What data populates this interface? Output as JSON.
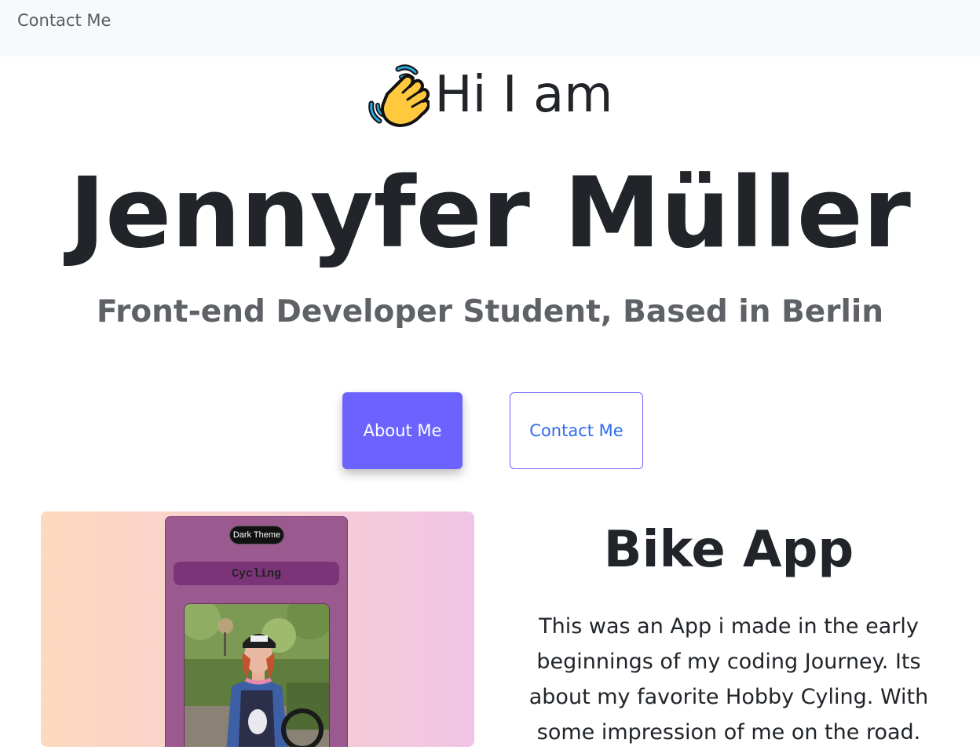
{
  "navbar": {
    "contact_link": "Contact Me"
  },
  "hero": {
    "greeting_icon": "waving-hand-icon",
    "greeting": "Hi I am",
    "name": "Jennyfer Müller",
    "subtitle": "Front-end Developer Student, Based in Berlin"
  },
  "buttons": {
    "about_label": "About Me",
    "contact_label": "Contact Me"
  },
  "colors": {
    "primary": "#6c63ff",
    "link": "#2f6bea",
    "text": "#212529",
    "muted": "#5e6166",
    "navbar_bg": "#f8f9fa"
  },
  "project": {
    "title": "Bike App",
    "description": "This was an App i made in the early beginnings of my coding Journey. Its about my favorite Hobby Cyling. With some impression of me on the road.",
    "preview": {
      "theme_button": "Dark Theme",
      "heading": "Cycling"
    }
  }
}
